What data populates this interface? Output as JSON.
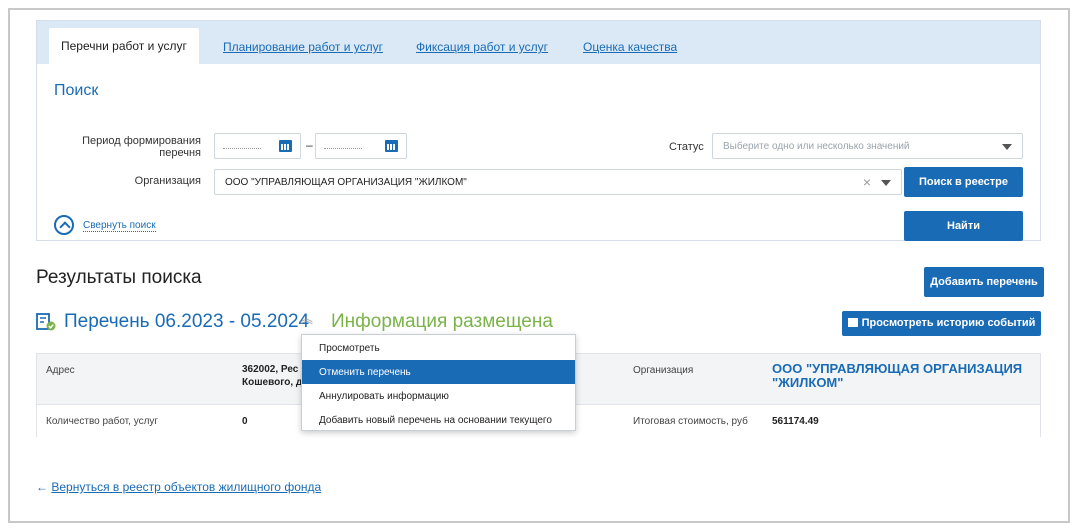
{
  "tabs": {
    "active": "Перечни работ и услуг",
    "planning": "Планирование работ и услуг",
    "fixation": "Фиксация работ и услуг",
    "quality": "Оценка качества"
  },
  "search": {
    "title": "Поиск",
    "period_label_line1": "Период формирования",
    "period_label_line2": "перечня",
    "period_separator": "–",
    "status_label": "Статус",
    "status_placeholder": "Выберите одно или несколько значений",
    "org_label": "Организация",
    "org_value": "ООО \"УПРАВЛЯЮЩАЯ ОРГАНИЗАЦИЯ \"ЖИЛКОМ\"",
    "clear_icon": "×",
    "registry_button": "Поиск в реестре",
    "find_button": "Найти",
    "collapse_link": "Свернуть поиск"
  },
  "results": {
    "title": "Результаты поиска",
    "add_button": "Добавить перечень",
    "history_button": "Просмотреть историю событий",
    "list_title": "Перечень 06.2023 - 05.2024",
    "list_status": "Информация размещена",
    "status_color": "#7bb34a",
    "table": {
      "address_label": "Адрес",
      "address_value_line1": "362002, Рес",
      "address_value_line2": "Кошевого, д",
      "org_label": "Организация",
      "org_value_line1": "ООО \"УПРАВЛЯЮЩАЯ ОРГАНИЗАЦИЯ",
      "org_value_line2": "\"ЖИЛКОМ\"",
      "works_label": "Количество работ, услуг",
      "works_value": "0",
      "cost_label": "Итоговая стоимость, руб",
      "cost_value": "561174.49"
    }
  },
  "dropdown": {
    "items": [
      "Просмотреть",
      "Отменить перечень",
      "Аннулировать информацию",
      "Добавить новый перечень на основании текущего"
    ],
    "selected_index": 1
  },
  "footer": {
    "back_arrow": "←",
    "back_link": "Вернуться в реестр объектов жилищного фонда"
  },
  "colors": {
    "accent": "#1a6bb5",
    "tab_bar": "#dbe9f6"
  }
}
